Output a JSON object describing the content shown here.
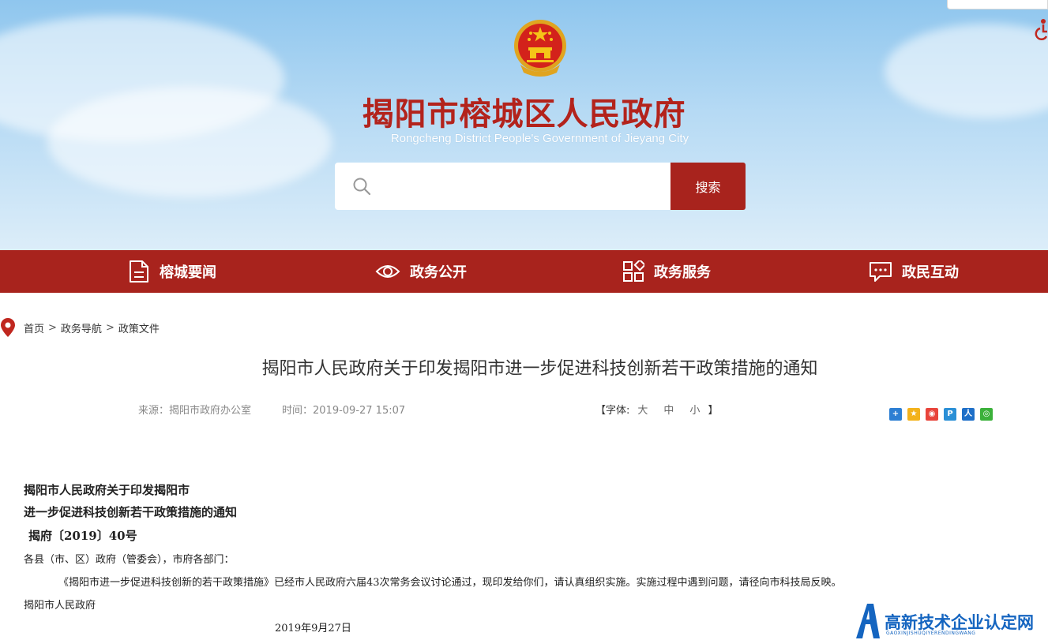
{
  "header": {
    "title": "揭阳市榕城区人民政府",
    "subtitle": "Rongcheng District People's Government of Jieyang City",
    "search": {
      "placeholder": "",
      "button_label": "搜索"
    }
  },
  "nav": {
    "items": [
      {
        "label": "榕城要闻",
        "icon": "document-icon"
      },
      {
        "label": "政务公开",
        "icon": "eye-icon"
      },
      {
        "label": "政务服务",
        "icon": "grid-icon"
      },
      {
        "label": "政民互动",
        "icon": "chat-icon"
      }
    ]
  },
  "breadcrumb": {
    "items": [
      "首页",
      "政务导航",
      "政策文件"
    ],
    "separator": ">"
  },
  "article": {
    "title": "揭阳市人民政府关于印发揭阳市进一步促进科技创新若干政策措施的通知",
    "source": "来源：揭阳市政府办公室",
    "time": "时间：2019-09-27 15:07",
    "font_size": {
      "open": "【字体:",
      "large": "大",
      "medium": "中",
      "small": "小",
      "close": "】"
    },
    "share_icons": [
      "plus-share-icon",
      "qzone-icon",
      "weibo-icon",
      "pengyou-icon",
      "renren-icon",
      "wechat-icon"
    ]
  },
  "document": {
    "heading_line1": "揭阳市人民政府关于印发揭阳市",
    "heading_line2": "进一步促进科技创新若干政策措施的通知",
    "doc_number": "揭府〔2019〕40号",
    "recipients": "各县（市、区）政府（管委会），市府各部门：",
    "body": "《揭阳市进一步促进科技创新的若干政策措施》已经市人民政府六届43次常务会议讨论通过，现印发给你们，请认真组织实施。实施过程中遇到问题，请径向市科技局反映。",
    "signature": "揭阳市人民政府",
    "date": "2019年9月27日"
  },
  "watermark": {
    "title": "高新技术企业认定网",
    "subtitle": "GAOXINJISHUQIYERENDINGWANG"
  },
  "colors": {
    "brand_red": "#a8231d",
    "title_red": "#b3231c",
    "watermark_blue": "#1565c0"
  }
}
